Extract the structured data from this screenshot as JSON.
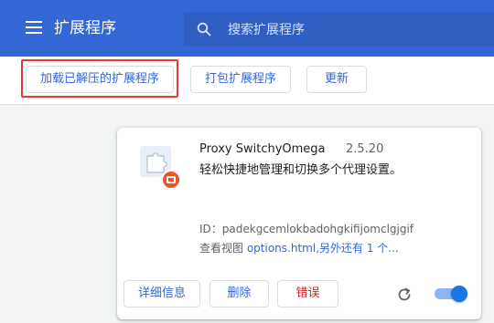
{
  "header": {
    "title": "扩展程序",
    "search_placeholder": "搜索扩展程序"
  },
  "toolbar": {
    "load_unpacked_label": "加载已解压的扩展程序",
    "pack_label": "打包扩展程序",
    "update_label": "更新"
  },
  "extension": {
    "name": "Proxy SwitchyOmega",
    "version": "2.5.20",
    "description": "轻松快捷地管理和切换多个代理设置。",
    "id_line": "ID：padekgcemlokbadohgkifijomclgjgif",
    "views_prefix": "查看视图 ",
    "views_link": "options.html",
    "views_suffix": ",另外还有 1 个...",
    "details_label": "详细信息",
    "remove_label": "删除",
    "errors_label": "错误",
    "enabled": true
  },
  "icons": {
    "menu": "hamburger-menu-icon",
    "search": "search-icon",
    "extension": "puzzle-piece-icon",
    "badge": "record-badge-icon",
    "reload": "reload-icon"
  },
  "colors": {
    "header_bg": "#3367d6",
    "accent": "#3367d6",
    "error": "#c5221f",
    "highlight": "#e53935",
    "toggle_on": "#1a73e8"
  }
}
